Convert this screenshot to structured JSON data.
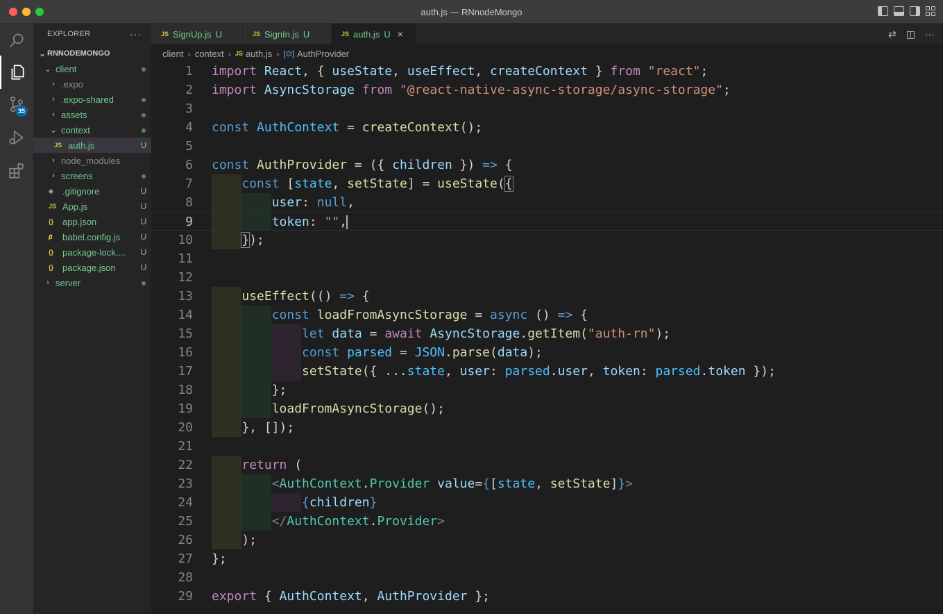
{
  "window": {
    "title": "auth.js — RNnodeMongo"
  },
  "activity_bar": {
    "items": [
      {
        "name": "search-icon"
      },
      {
        "name": "explorer-icon"
      },
      {
        "name": "source-control-icon",
        "badge": "35"
      },
      {
        "name": "run-debug-icon"
      },
      {
        "name": "extensions-icon"
      }
    ]
  },
  "sidebar": {
    "header": "EXPLORER",
    "more": "···",
    "root": "RNNODEMONGO",
    "items": [
      {
        "label": "client",
        "chevron": "⌄",
        "status": "dot"
      },
      {
        "label": ".expo",
        "chevron": "›",
        "status": ""
      },
      {
        "label": ".expo-shared",
        "chevron": "›",
        "status": "dot"
      },
      {
        "label": "assets",
        "chevron": "›",
        "status": "dot"
      },
      {
        "label": "context",
        "chevron": "⌄",
        "status": "dot"
      },
      {
        "label": "auth.js",
        "icon": "JS",
        "status": "U"
      },
      {
        "label": "node_modules",
        "chevron": "›",
        "status": ""
      },
      {
        "label": "screens",
        "chevron": "›",
        "status": "dot"
      },
      {
        "label": ".gitignore",
        "icon": "◆",
        "status": "U"
      },
      {
        "label": "App.js",
        "icon": "JS",
        "status": "U"
      },
      {
        "label": "app.json",
        "icon": "{}",
        "status": "U"
      },
      {
        "label": "babel.config.js",
        "icon": "β",
        "status": "U"
      },
      {
        "label": "package-lock....",
        "icon": "{}",
        "status": "U"
      },
      {
        "label": "package.json",
        "icon": "{}",
        "status": "U"
      },
      {
        "label": "server",
        "chevron": "›",
        "status": "dot"
      }
    ]
  },
  "tabs": [
    {
      "icon": "JS",
      "label": "SignUp.js",
      "status": "U"
    },
    {
      "icon": "JS",
      "label": "SignIn.js",
      "status": "U"
    },
    {
      "icon": "JS",
      "label": "auth.js",
      "status": "U",
      "close": "×"
    }
  ],
  "breadcrumb": {
    "parts": [
      "client",
      "context",
      "auth.js",
      "AuthProvider"
    ],
    "js_icon": "JS",
    "symbol_icon": "[⊙]",
    "sep": "›"
  },
  "editor": {
    "current_line": 9,
    "lines": [
      {
        "n": "1",
        "tokens": [
          [
            "kw",
            "import"
          ],
          [
            "pu",
            " "
          ],
          [
            "vr",
            "React"
          ],
          [
            "pu",
            ", { "
          ],
          [
            "vr",
            "useState"
          ],
          [
            "pu",
            ", "
          ],
          [
            "vr",
            "useEffect"
          ],
          [
            "pu",
            ", "
          ],
          [
            "vr",
            "createContext"
          ],
          [
            "pu",
            " } "
          ],
          [
            "kw",
            "from"
          ],
          [
            "pu",
            " "
          ],
          [
            "str",
            "\"react\""
          ],
          [
            "pu",
            ";"
          ]
        ]
      },
      {
        "n": "2",
        "tokens": [
          [
            "kw",
            "import"
          ],
          [
            "pu",
            " "
          ],
          [
            "vr",
            "AsyncStorage"
          ],
          [
            "pu",
            " "
          ],
          [
            "kw",
            "from"
          ],
          [
            "pu",
            " "
          ],
          [
            "str",
            "\"@react-native-async-storage/async-storage\""
          ],
          [
            "pu",
            ";"
          ]
        ]
      },
      {
        "n": "3",
        "tokens": []
      },
      {
        "n": "4",
        "tokens": [
          [
            "st",
            "const"
          ],
          [
            "pu",
            " "
          ],
          [
            "cn",
            "AuthContext"
          ],
          [
            "pu",
            " = "
          ],
          [
            "fn",
            "createContext"
          ],
          [
            "pu",
            "();"
          ]
        ]
      },
      {
        "n": "5",
        "tokens": []
      },
      {
        "n": "6",
        "tokens": [
          [
            "st",
            "const"
          ],
          [
            "pu",
            " "
          ],
          [
            "fn",
            "AuthProvider"
          ],
          [
            "pu",
            " = ({ "
          ],
          [
            "vr",
            "children"
          ],
          [
            "pu",
            " }) "
          ],
          [
            "st",
            "=>"
          ],
          [
            "pu",
            " {"
          ]
        ]
      },
      {
        "n": "7",
        "tokens": [
          [
            "pu",
            "    "
          ],
          [
            "st",
            "const"
          ],
          [
            "pu",
            " ["
          ],
          [
            "cn",
            "state"
          ],
          [
            "pu",
            ", "
          ],
          [
            "fn",
            "setState"
          ],
          [
            "pu",
            "] = "
          ],
          [
            "fn",
            "useState"
          ],
          [
            "pu",
            "("
          ],
          [
            "pu",
            "{"
          ]
        ]
      },
      {
        "n": "8",
        "tokens": [
          [
            "pu",
            "        "
          ],
          [
            "vr",
            "user"
          ],
          [
            "pu",
            ": "
          ],
          [
            "st",
            "null"
          ],
          [
            "pu",
            ","
          ]
        ]
      },
      {
        "n": "9",
        "tokens": [
          [
            "pu",
            "        "
          ],
          [
            "vr",
            "token"
          ],
          [
            "pu",
            ": "
          ],
          [
            "str",
            "\"\""
          ],
          [
            "pu",
            ","
          ]
        ]
      },
      {
        "n": "10",
        "tokens": [
          [
            "pu",
            "    "
          ],
          [
            "pu",
            "}"
          ],
          [
            "pu",
            ");"
          ]
        ]
      },
      {
        "n": "11",
        "tokens": []
      },
      {
        "n": "12",
        "tokens": []
      },
      {
        "n": "13",
        "tokens": [
          [
            "pu",
            "    "
          ],
          [
            "fn",
            "useEffect"
          ],
          [
            "pu",
            "(() "
          ],
          [
            "st",
            "=>"
          ],
          [
            "pu",
            " {"
          ]
        ]
      },
      {
        "n": "14",
        "tokens": [
          [
            "pu",
            "        "
          ],
          [
            "st",
            "const"
          ],
          [
            "pu",
            " "
          ],
          [
            "fn",
            "loadFromAsyncStorage"
          ],
          [
            "pu",
            " = "
          ],
          [
            "st",
            "async"
          ],
          [
            "pu",
            " () "
          ],
          [
            "st",
            "=>"
          ],
          [
            "pu",
            " {"
          ]
        ]
      },
      {
        "n": "15",
        "tokens": [
          [
            "pu",
            "            "
          ],
          [
            "st",
            "let"
          ],
          [
            "pu",
            " "
          ],
          [
            "vr",
            "data"
          ],
          [
            "pu",
            " = "
          ],
          [
            "kw",
            "await"
          ],
          [
            "pu",
            " "
          ],
          [
            "vr",
            "AsyncStorage"
          ],
          [
            "pu",
            "."
          ],
          [
            "fn",
            "getItem"
          ],
          [
            "pu",
            "("
          ],
          [
            "str",
            "\"auth-rn\""
          ],
          [
            "pu",
            ");"
          ]
        ]
      },
      {
        "n": "16",
        "tokens": [
          [
            "pu",
            "            "
          ],
          [
            "st",
            "const"
          ],
          [
            "pu",
            " "
          ],
          [
            "cn",
            "parsed"
          ],
          [
            "pu",
            " = "
          ],
          [
            "cn",
            "JSON"
          ],
          [
            "pu",
            "."
          ],
          [
            "fn",
            "parse"
          ],
          [
            "pu",
            "("
          ],
          [
            "vr",
            "data"
          ],
          [
            "pu",
            ");"
          ]
        ]
      },
      {
        "n": "17",
        "tokens": [
          [
            "pu",
            "            "
          ],
          [
            "fn",
            "setState"
          ],
          [
            "pu",
            "({ ..."
          ],
          [
            "cn",
            "state"
          ],
          [
            "pu",
            ", "
          ],
          [
            "vr",
            "user"
          ],
          [
            "pu",
            ": "
          ],
          [
            "cn",
            "parsed"
          ],
          [
            "pu",
            "."
          ],
          [
            "vr",
            "user"
          ],
          [
            "pu",
            ", "
          ],
          [
            "vr",
            "token"
          ],
          [
            "pu",
            ": "
          ],
          [
            "cn",
            "parsed"
          ],
          [
            "pu",
            "."
          ],
          [
            "vr",
            "token"
          ],
          [
            "pu",
            " });"
          ]
        ]
      },
      {
        "n": "18",
        "tokens": [
          [
            "pu",
            "        };"
          ]
        ]
      },
      {
        "n": "19",
        "tokens": [
          [
            "pu",
            "        "
          ],
          [
            "fn",
            "loadFromAsyncStorage"
          ],
          [
            "pu",
            "();"
          ]
        ]
      },
      {
        "n": "20",
        "tokens": [
          [
            "pu",
            "    }, []);"
          ]
        ]
      },
      {
        "n": "21",
        "tokens": []
      },
      {
        "n": "22",
        "tokens": [
          [
            "pu",
            "    "
          ],
          [
            "kw",
            "return"
          ],
          [
            "pu",
            " ("
          ]
        ]
      },
      {
        "n": "23",
        "tokens": [
          [
            "pu",
            "        "
          ],
          [
            "tg",
            "<"
          ],
          [
            "ty",
            "AuthContext"
          ],
          [
            "pu",
            "."
          ],
          [
            "ty",
            "Provider"
          ],
          [
            "pu",
            " "
          ],
          [
            "vr",
            "value"
          ],
          [
            "pu",
            "="
          ],
          [
            "st",
            "{"
          ],
          [
            "pu",
            "["
          ],
          [
            "cn",
            "state"
          ],
          [
            "pu",
            ", "
          ],
          [
            "fn",
            "setState"
          ],
          [
            "pu",
            "]"
          ],
          [
            "st",
            "}"
          ],
          [
            "tg",
            ">"
          ]
        ]
      },
      {
        "n": "24",
        "tokens": [
          [
            "pu",
            "            "
          ],
          [
            "st",
            "{"
          ],
          [
            "vr",
            "children"
          ],
          [
            "st",
            "}"
          ]
        ]
      },
      {
        "n": "25",
        "tokens": [
          [
            "pu",
            "        "
          ],
          [
            "tg",
            "</"
          ],
          [
            "ty",
            "AuthContext"
          ],
          [
            "pu",
            "."
          ],
          [
            "ty",
            "Provider"
          ],
          [
            "tg",
            ">"
          ]
        ]
      },
      {
        "n": "26",
        "tokens": [
          [
            "pu",
            "    );"
          ]
        ]
      },
      {
        "n": "27",
        "tokens": [
          [
            "pu",
            "};"
          ]
        ]
      },
      {
        "n": "28",
        "tokens": []
      },
      {
        "n": "29",
        "tokens": [
          [
            "kw",
            "export"
          ],
          [
            "pu",
            " { "
          ],
          [
            "vr",
            "AuthContext"
          ],
          [
            "pu",
            ", "
          ],
          [
            "vr",
            "AuthProvider"
          ],
          [
            "pu",
            " };"
          ]
        ]
      }
    ]
  }
}
